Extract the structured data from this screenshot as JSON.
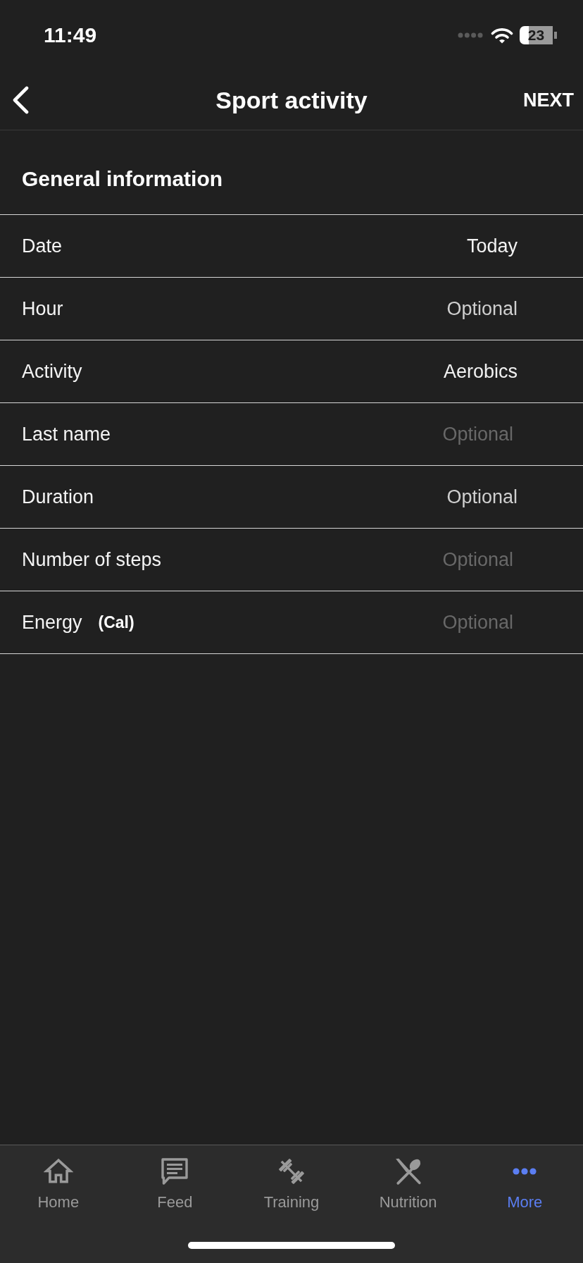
{
  "status_bar": {
    "time": "11:49",
    "battery": "23"
  },
  "header": {
    "title": "Sport activity",
    "action": "NEXT"
  },
  "section": {
    "title": "General information"
  },
  "fields": [
    {
      "label": "Date",
      "kind": "picker",
      "value": "Today"
    },
    {
      "label": "Hour",
      "kind": "picker",
      "placeholder": "Optional"
    },
    {
      "label": "Activity",
      "kind": "picker",
      "value": "Aerobics"
    },
    {
      "label": "Last name",
      "kind": "input",
      "placeholder": "Optional"
    },
    {
      "label": "Duration",
      "kind": "picker",
      "placeholder": "Optional"
    },
    {
      "label": "Number of steps",
      "kind": "input",
      "placeholder": "Optional"
    },
    {
      "label": "Energy",
      "unit": "(Cal)",
      "kind": "input",
      "placeholder": "Optional"
    }
  ],
  "tab_bar": {
    "tabs": [
      {
        "label": "Home",
        "selected": false
      },
      {
        "label": "Feed",
        "selected": false
      },
      {
        "label": "Training",
        "selected": false
      },
      {
        "label": "Nutrition",
        "selected": false
      },
      {
        "label": "More",
        "selected": true
      }
    ]
  }
}
